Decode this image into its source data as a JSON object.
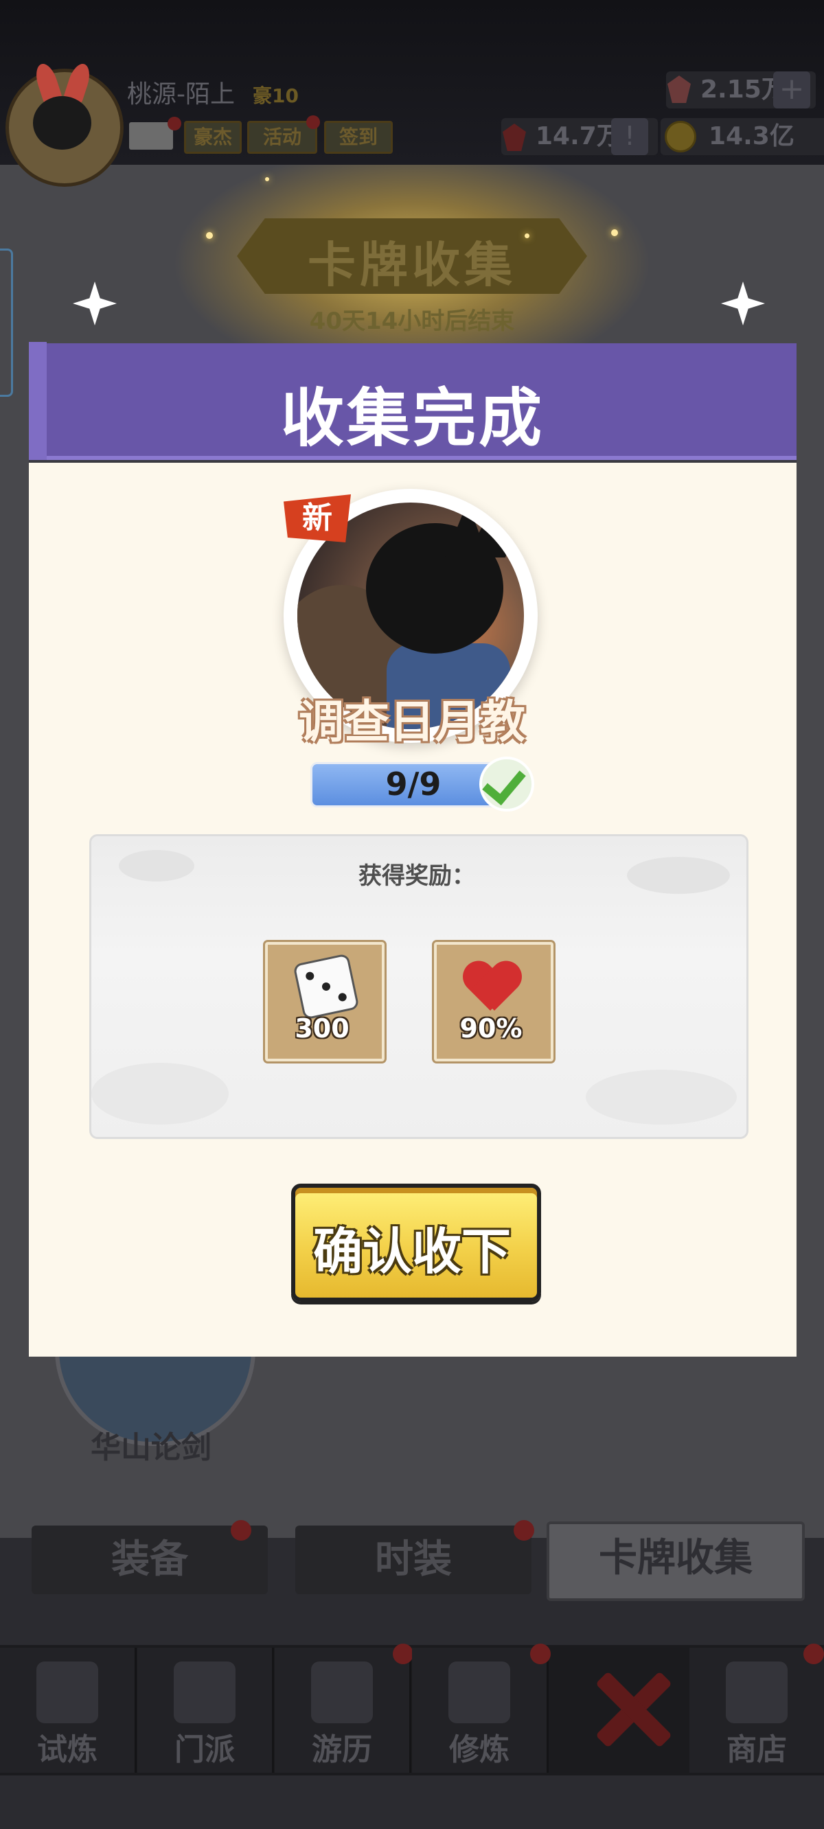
{
  "header": {
    "player_name": "桃源-陌上",
    "rank": "豪10",
    "buttons": [
      "豪杰",
      "活动",
      "签到"
    ],
    "gems": "2.15万",
    "tokens": "14.7万",
    "gold": "14.3亿"
  },
  "event": {
    "title": "卡牌收集",
    "countdown": "40天14小时后结束"
  },
  "modal": {
    "title": "收集完成",
    "new_badge": "新",
    "card_name": "调查日月教",
    "progress_text": "9/9",
    "progress_fraction": 1.0,
    "reward_title": "获得奖励：",
    "rewards": [
      {
        "icon": "dice-icon",
        "value": "300"
      },
      {
        "icon": "heart-icon",
        "value": "90%"
      }
    ],
    "confirm_label": "确认收下"
  },
  "background": {
    "huashan_label": "华山论剑"
  },
  "tabs": [
    "装备",
    "时装",
    "卡牌收集"
  ],
  "nav": [
    "试炼",
    "门派",
    "游历",
    "修炼",
    "商店"
  ]
}
